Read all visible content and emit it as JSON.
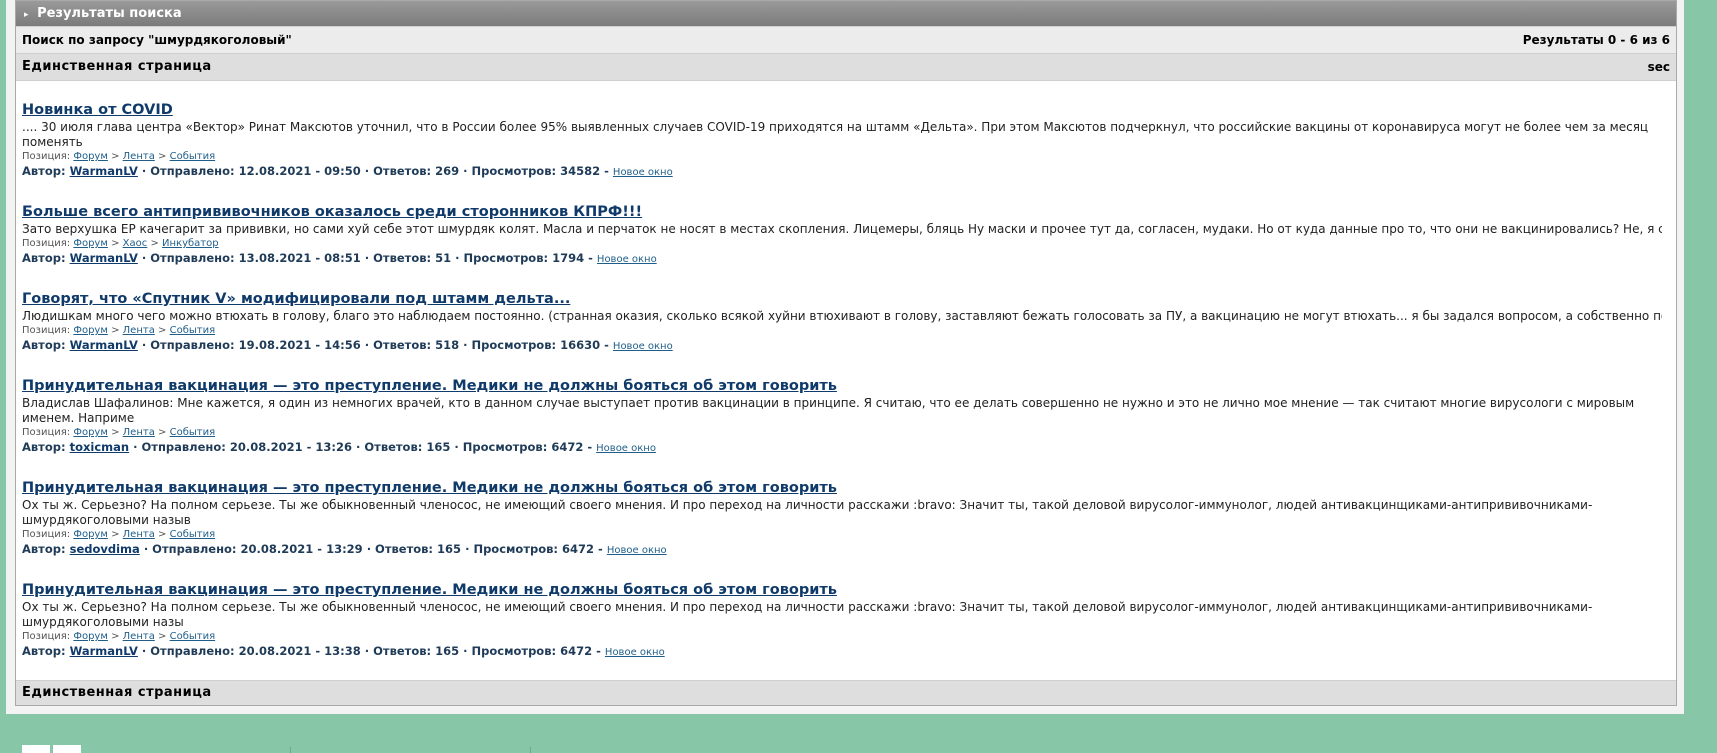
{
  "panel": {
    "title": "Результаты поиска",
    "query_text": "Поиск по запросу \"шмурдякоголовый\"",
    "results_count": "Результаты 0 - 6 из 6",
    "page_label": "Единственная страница",
    "sec_label": "sec",
    "footer_page_label": "Единственная страница"
  },
  "labels": {
    "position": "Позиция:",
    "author": "Автор:",
    "sent": "· Отправлено:",
    "replies": "· Ответов:",
    "views": "· Просмотров:",
    "new_window": "Новое окно",
    "sep": ">",
    "dash": "-"
  },
  "results": [
    {
      "title": "Новинка от COVID",
      "snippet": ".... 30 июля глава центра «Вектор» Ринат Максютов уточнил, что в России более 95% выявленных случаев COVID-19 приходятся на штамм «Дельта». При этом Максютов подчеркнул, что российские вакцины от коронавируса могут не более чем за месяц поменять",
      "path": [
        "Форум",
        "Лента",
        "События"
      ],
      "author": "WarmanLV",
      "date": "12.08.2021 - 09:50",
      "replies": "269",
      "views": "34582"
    },
    {
      "title": "Больше всего антипрививочников оказалось среди сторонников КПРФ!!!",
      "snippet": "Зато верхушка ЕР качегарит за прививки, но сами хуй себе этот шмурдяк колят. Масла и перчаток не носят в местах скопления. Лицемеры, бляць Ну маски и прочее тут да, согласен, мудаки. Но от куда данные про то, что они не вакцинировались? Не, я согл",
      "path": [
        "Форум",
        "Хаос",
        "Инкубатор"
      ],
      "author": "WarmanLV",
      "date": "13.08.2021 - 08:51",
      "replies": "51",
      "views": "1794"
    },
    {
      "title": "Говорят, что «Спутник V» модифицировали под штамм дельта...",
      "snippet": "Людишкам много чего можно втюхать в голову, благо это наблюдаем постоянно. (странная оказия, сколько всякой хуйни втюхивают в голову, заставляют бежать голосовать за ПУ, а вакцинацию не могут втюхать... я бы задался вопросом, а собственно поче",
      "path": [
        "Форум",
        "Лента",
        "События"
      ],
      "author": "WarmanLV",
      "date": "19.08.2021 - 14:56",
      "replies": "518",
      "views": "16630"
    },
    {
      "title": "Принудительная вакцинация — это преступление. Медики не должны бояться об этом говорить",
      "snippet": "Владислав Шафалинов: Мне кажется, я один из немногих врачей, кто в данном случае выступает против вакцинации в принципе. Я считаю, что ее делать совершенно не нужно и это не лично мое мнение — так считают многие вирусологи с мировым именем. Наприме",
      "path": [
        "Форум",
        "Лента",
        "События"
      ],
      "author": "toxicman",
      "date": "20.08.2021 - 13:26",
      "replies": "165",
      "views": "6472"
    },
    {
      "title": "Принудительная вакцинация — это преступление. Медики не должны бояться об этом говорить",
      "snippet": "Ох ты ж. Серьезно? На полном серьезе. Ты же обыкновенный членосос, не имеющий своего мнения. И про переход на личности расскажи :bravo: Значит ты, такой деловой вирусолог-иммунолог, людей антивакцинщиками-антипрививочниками-шмурдякоголовыми назыв",
      "path": [
        "Форум",
        "Лента",
        "События"
      ],
      "author": "sedovdima",
      "date": "20.08.2021 - 13:29",
      "replies": "165",
      "views": "6472"
    },
    {
      "title": "Принудительная вакцинация — это преступление. Медики не должны бояться об этом говорить",
      "snippet": "Ох ты ж. Серьезно? На полном серьезе. Ты же обыкновенный членосос, не имеющий своего мнения. И про переход на личности расскажи :bravo: Значит ты, такой деловой вирусолог-иммунолог, людей антивакцинщиками-антипрививочниками-шмурдякоголовыми назы",
      "path": [
        "Форум",
        "Лента",
        "События"
      ],
      "author": "WarmanLV",
      "date": "20.08.2021 - 13:38",
      "replies": "165",
      "views": "6472"
    }
  ],
  "colors": {
    "background": "#87c6a6",
    "title_link": "#0f3a69",
    "meta_text": "#1f3b57"
  }
}
